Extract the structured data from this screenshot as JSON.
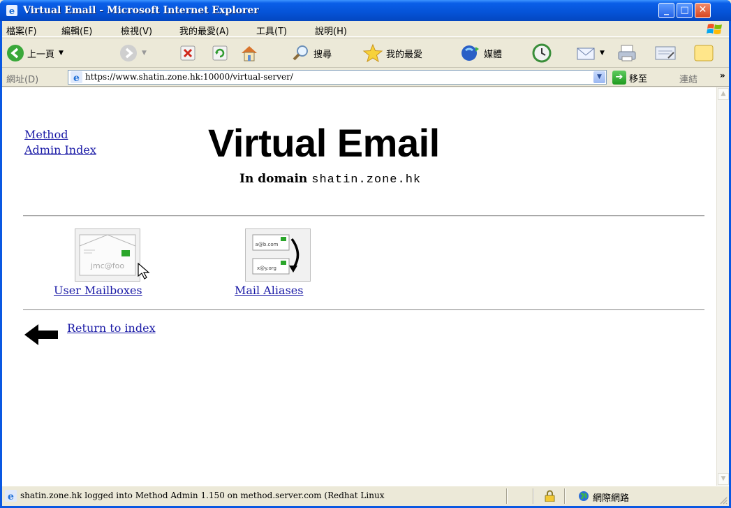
{
  "window": {
    "title": "Virtual Email - Microsoft Internet Explorer",
    "controls": {
      "minimize": "_",
      "maximize": "□",
      "close": "✕"
    }
  },
  "menu": [
    "檔案(F)",
    "編輯(E)",
    "檢視(V)",
    "我的最愛(A)",
    "工具(T)",
    "說明(H)"
  ],
  "toolbar": {
    "back_label": "上一頁",
    "search_label": "搜尋",
    "favorites_label": "我的最愛",
    "media_label": "媒體"
  },
  "address_bar": {
    "label": "網址(D)",
    "url": "https://www.shatin.zone.hk:10000/virtual-server/",
    "go_label": "移至",
    "links_label": "連結",
    "more": "»"
  },
  "page": {
    "nav_links": [
      "Method",
      "Admin Index"
    ],
    "title": "Virtual Email",
    "domain_label": "In domain",
    "domain": "shatin.zone.hk",
    "icons": [
      {
        "label": "User Mailboxes",
        "icon_text": "jmc@foo"
      },
      {
        "label": "Mail Aliases",
        "icon_text_top": "a@b.com",
        "icon_text_bottom": "x@y.org"
      }
    ],
    "return_link": "Return to index"
  },
  "status_bar": {
    "text": "shatin.zone.hk logged into Method Admin 1.150 on method.server.com (Redhat Linux",
    "zone": "網際網路"
  },
  "colors": {
    "titlebar": "#0553d7",
    "link": "#1a1aa6",
    "chrome": "#ece9d8"
  }
}
